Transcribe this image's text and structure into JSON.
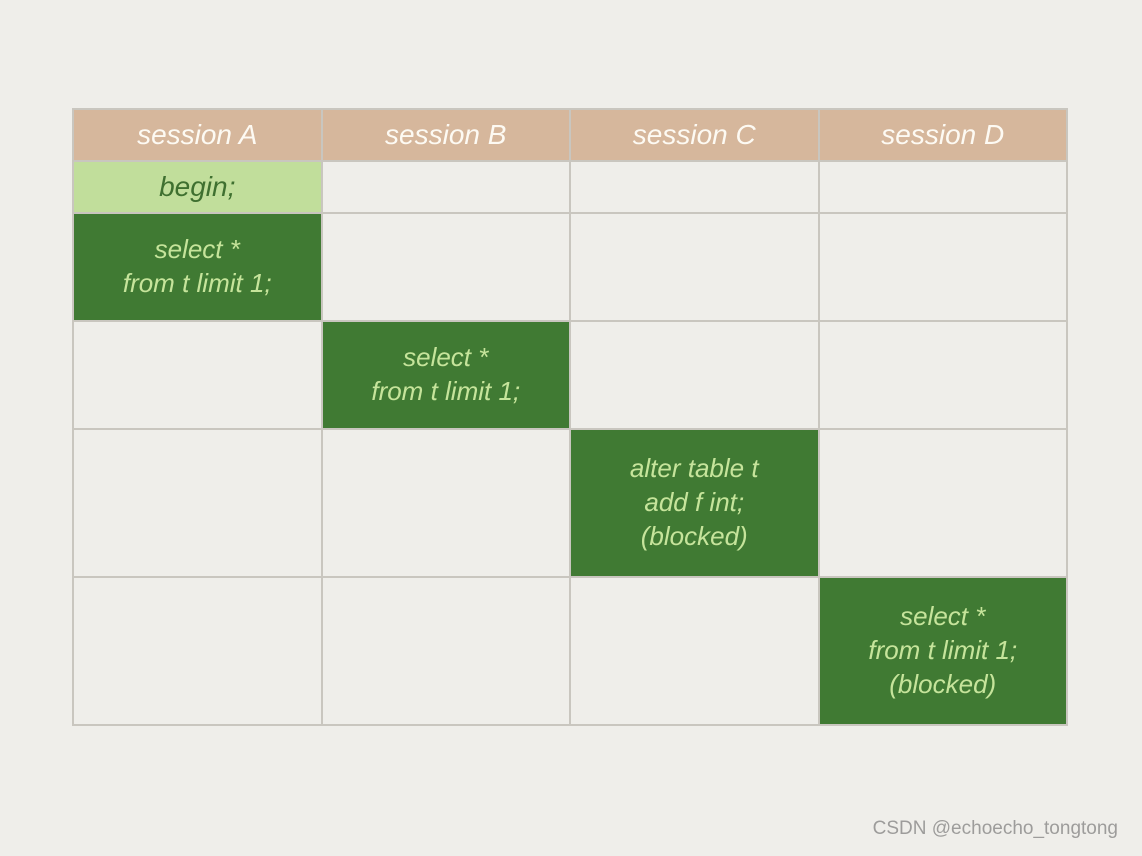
{
  "headers": [
    "session A",
    "session B",
    "session C",
    "session D"
  ],
  "rows": [
    {
      "col": 0,
      "style": "light",
      "text": "begin;"
    },
    {
      "col": 0,
      "style": "dark",
      "text": "select *\nfrom t limit 1;"
    },
    {
      "col": 1,
      "style": "dark",
      "text": "select *\nfrom t limit 1;"
    },
    {
      "col": 2,
      "style": "dark",
      "text": "alter table t\nadd f int;\n(blocked)"
    },
    {
      "col": 3,
      "style": "dark",
      "text": "select *\nfrom t limit 1;\n(blocked)"
    }
  ],
  "watermark": "CSDN @echoecho_tongtong"
}
